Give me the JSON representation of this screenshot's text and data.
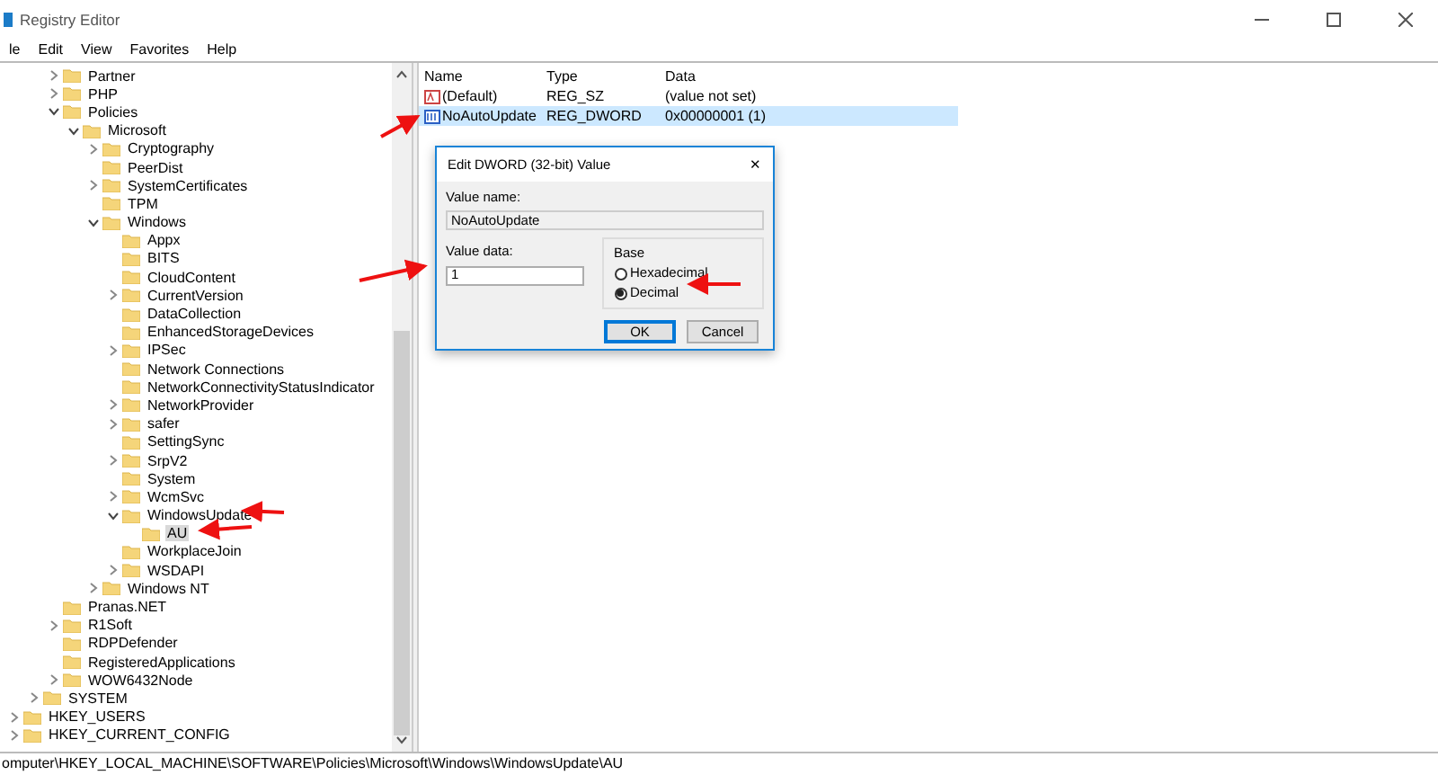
{
  "window": {
    "title": "Registry Editor"
  },
  "menu": [
    "le",
    "Edit",
    "View",
    "Favorites",
    "Help"
  ],
  "tree": [
    {
      "kind": "hidden",
      "children": [
        {
          "kind": "hidden",
          "children": [
            {
              "label": "Partner",
              "kind": "branch",
              "expanded": false,
              "selected": false
            },
            {
              "label": "PHP",
              "kind": "branch",
              "expanded": false,
              "selected": false
            },
            {
              "label": "Policies",
              "kind": "branch",
              "expanded": true,
              "selected": false,
              "children": [
                {
                  "label": "Microsoft",
                  "kind": "branch",
                  "expanded": true,
                  "selected": false,
                  "children": [
                    {
                      "label": "Cryptography",
                      "kind": "branch",
                      "expanded": false,
                      "selected": false
                    },
                    {
                      "label": "PeerDist",
                      "kind": "leaf",
                      "selected": false
                    },
                    {
                      "label": "SystemCertificates",
                      "kind": "branch",
                      "expanded": false,
                      "selected": false
                    },
                    {
                      "label": "TPM",
                      "kind": "leaf",
                      "selected": false
                    },
                    {
                      "label": "Windows",
                      "kind": "branch",
                      "expanded": true,
                      "selected": false,
                      "children": [
                        {
                          "label": "Appx",
                          "kind": "leaf",
                          "selected": false
                        },
                        {
                          "label": "BITS",
                          "kind": "leaf",
                          "selected": false
                        },
                        {
                          "label": "CloudContent",
                          "kind": "leaf",
                          "selected": false
                        },
                        {
                          "label": "CurrentVersion",
                          "kind": "branch",
                          "expanded": false,
                          "selected": false
                        },
                        {
                          "label": "DataCollection",
                          "kind": "leaf",
                          "selected": false
                        },
                        {
                          "label": "EnhancedStorageDevices",
                          "kind": "leaf",
                          "selected": false
                        },
                        {
                          "label": "IPSec",
                          "kind": "branch",
                          "expanded": false,
                          "selected": false
                        },
                        {
                          "label": "Network Connections",
                          "kind": "leaf",
                          "selected": false
                        },
                        {
                          "label": "NetworkConnectivityStatusIndicator",
                          "kind": "leaf",
                          "selected": false
                        },
                        {
                          "label": "NetworkProvider",
                          "kind": "branch",
                          "expanded": false,
                          "selected": false
                        },
                        {
                          "label": "safer",
                          "kind": "branch",
                          "expanded": false,
                          "selected": false
                        },
                        {
                          "label": "SettingSync",
                          "kind": "leaf",
                          "selected": false
                        },
                        {
                          "label": "SrpV2",
                          "kind": "branch",
                          "expanded": false,
                          "selected": false
                        },
                        {
                          "label": "System",
                          "kind": "leaf",
                          "selected": false
                        },
                        {
                          "label": "WcmSvc",
                          "kind": "branch",
                          "expanded": false,
                          "selected": false
                        },
                        {
                          "label": "WindowsUpdate",
                          "kind": "branch",
                          "expanded": true,
                          "selected": false,
                          "children": [
                            {
                              "label": "AU",
                              "kind": "leaf",
                              "selected": true
                            }
                          ]
                        },
                        {
                          "label": "WorkplaceJoin",
                          "kind": "leaf",
                          "selected": false
                        },
                        {
                          "label": "WSDAPI",
                          "kind": "branch",
                          "expanded": false,
                          "selected": false
                        }
                      ]
                    },
                    {
                      "label": "Windows NT",
                      "kind": "branch",
                      "expanded": false,
                      "selected": false
                    }
                  ]
                }
              ]
            },
            {
              "label": "Pranas.NET",
              "kind": "leaf",
              "selected": false
            },
            {
              "label": "R1Soft",
              "kind": "branch",
              "expanded": false,
              "selected": false
            },
            {
              "label": "RDPDefender",
              "kind": "leaf",
              "selected": false
            },
            {
              "label": "RegisteredApplications",
              "kind": "leaf",
              "selected": false
            },
            {
              "label": "WOW6432Node",
              "kind": "branch",
              "expanded": false,
              "selected": false
            }
          ]
        },
        {
          "label": "SYSTEM",
          "kind": "branch",
          "expanded": false,
          "selected": false
        }
      ]
    },
    {
      "label": "HKEY_USERS",
      "kind": "branch",
      "expanded": false,
      "selected": false
    },
    {
      "label": "HKEY_CURRENT_CONFIG",
      "kind": "branch",
      "expanded": false,
      "selected": false
    }
  ],
  "values": {
    "columns": [
      "Name",
      "Type",
      "Data"
    ],
    "rows": [
      {
        "kind": "string",
        "name": "(Default)",
        "type": "REG_SZ",
        "data": "(value not set)",
        "selected": false
      },
      {
        "kind": "binary",
        "name": "NoAutoUpdate",
        "type": "REG_DWORD",
        "data": "0x00000001 (1)",
        "selected": true
      }
    ]
  },
  "dialog": {
    "title": "Edit DWORD (32-bit) Value",
    "close": "✕",
    "value_name_label": "Value name:",
    "value_name": "NoAutoUpdate",
    "value_data_label": "Value data:",
    "value_data": "1",
    "base_label": "Base",
    "base_options": [
      {
        "label": "Hexadecimal",
        "selected": false
      },
      {
        "label": "Decimal",
        "selected": true
      }
    ],
    "buttons": [
      {
        "label": "OK",
        "default": true
      },
      {
        "label": "Cancel",
        "default": false
      }
    ]
  },
  "status_bar": "omputer\\HKEY_LOCAL_MACHINE\\SOFTWARE\\Policies\\Microsoft\\Windows\\WindowsUpdate\\AU"
}
